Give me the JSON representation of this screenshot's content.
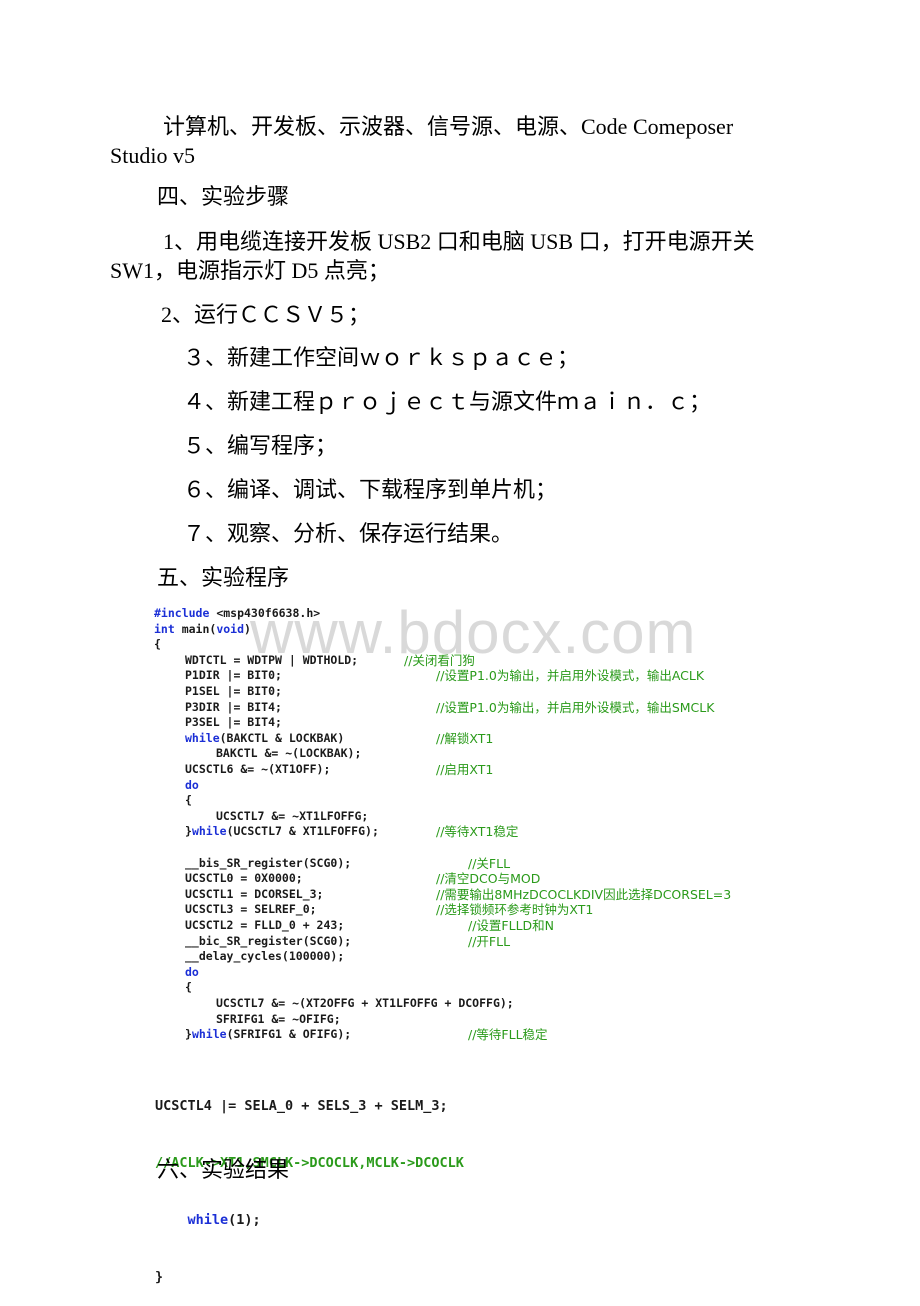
{
  "equipment": {
    "line1": "计算机、开发板、示波器、信号源、电源、Code Comeposer",
    "line2": "Studio v5"
  },
  "section4": {
    "heading": "四、实验步骤"
  },
  "steps": [
    {
      "text": "1、用电缆连接开发板 USB2 口和电脑 USB 口，打开电源开关"
    },
    {
      "text": "SW1，电源指示灯 D5 点亮；"
    },
    {
      "text": "2、运行ＣＣＳＶ５；"
    },
    {
      "text": "３、新建工作空间ｗｏｒｋｓｐａｃｅ；"
    },
    {
      "text": "４、新建工程ｐｒｏｊｅｃｔ与源文件ｍａｉｎ．ｃ；"
    },
    {
      "text": "５、编写程序；"
    },
    {
      "text": "６、编译、调试、下载程序到单片机；"
    },
    {
      "text": "７、观察、分析、保存运行结果。"
    }
  ],
  "section5": {
    "heading": "五、实验程序"
  },
  "watermark": "www.bdocx.com",
  "code": {
    "lines": [
      {
        "kw1": "#include",
        "text": " <msp430f6638.h>",
        "indent": 0
      },
      {
        "kw1": "int",
        "text": " main(",
        "kw2": "void",
        "text2": ")",
        "indent": 0
      },
      {
        "text": "{",
        "indent": 0
      },
      {
        "text": "WDTCTL = WDTPW | WDTHOLD;",
        "indent": 1,
        "comment": "//关闭看门狗"
      },
      {
        "text": "P1DIR |= BIT0;",
        "indent": 1,
        "comment": "//设置P1.0为输出，并启用外设模式，输出ACLK"
      },
      {
        "text": "P1SEL |= BIT0;",
        "indent": 1
      },
      {
        "text": "P3DIR |= BIT4;",
        "indent": 1,
        "comment": "//设置P1.0为输出，并启用外设模式，输出SMCLK"
      },
      {
        "text": "P3SEL |= BIT4;",
        "indent": 1
      },
      {
        "kw1": "while",
        "text": "(BAKCTL & LOCKBAK)",
        "indent": 1,
        "comment": "//解锁XT1"
      },
      {
        "text": "BAKCTL &= ~(LOCKBAK);",
        "indent": 2
      },
      {
        "text": "UCSCTL6 &= ~(XT1OFF);",
        "indent": 1,
        "comment": "//启用XT1"
      },
      {
        "kw1": "do",
        "indent": 1
      },
      {
        "text": "{",
        "indent": 1
      },
      {
        "text": "UCSCTL7 &= ~XT1LFOFFG;",
        "indent": 2
      },
      {
        "text": "}",
        "kw2": "while",
        "text2": "(UCSCTL7 & XT1LFOFFG);",
        "indent": 1,
        "comment": "//等待XT1稳定"
      },
      {
        "text": "",
        "indent": 0
      },
      {
        "text": "__bis_SR_register(SCG0);",
        "indent": 1,
        "comment": "//关FLL"
      },
      {
        "text": "UCSCTL0 = 0X0000;",
        "indent": 1,
        "comment": "//清空DCO与MOD"
      },
      {
        "text": "UCSCTL1 = DCORSEL_3;",
        "indent": 1,
        "comment": "//需要输出8MHzDCOCLKDIV因此选择DCORSEL=3"
      },
      {
        "text": "UCSCTL3 = SELREF_0;",
        "indent": 1,
        "comment": "//选择锁频环参考时钟为XT1"
      },
      {
        "text": "UCSCTL2 = FLLD_0 + 243;",
        "indent": 1,
        "comment": "//设置FLLD和N"
      },
      {
        "text": "__bic_SR_register(SCG0);",
        "indent": 1,
        "comment": "//开FLL"
      },
      {
        "text": "__delay_cycles(100000);",
        "indent": 1
      },
      {
        "kw1": "do",
        "indent": 1
      },
      {
        "text": "{",
        "indent": 1
      },
      {
        "text": "UCSCTL7 &= ~(XT2OFFG + XT1LFOFFG + DCOFFG);",
        "indent": 2
      },
      {
        "text": "SFRIFG1 &= ~OFIFG;",
        "indent": 2
      },
      {
        "text": "}",
        "kw2": "while",
        "text2": "(SFRIFG1 & OFIFG);",
        "indent": 1,
        "comment": "//等待FLL稳定"
      }
    ],
    "tail": {
      "line1": "UCSCTL4 |= SELA_0 + SELS_3 + SELM_3;",
      "line2": "//ACLK->XT1,SMCLK->DCOCLK,MCLK->DCOCLK",
      "line3_kw": "while",
      "line3_rest": "(1);",
      "line4": "}"
    }
  },
  "section6": {
    "heading": "六、实验结果"
  },
  "colors": {
    "keyword": "#1b2fd6",
    "comment": "#2a9a1a",
    "text": "#1a1a1a",
    "watermark": "#d9d9d9"
  }
}
